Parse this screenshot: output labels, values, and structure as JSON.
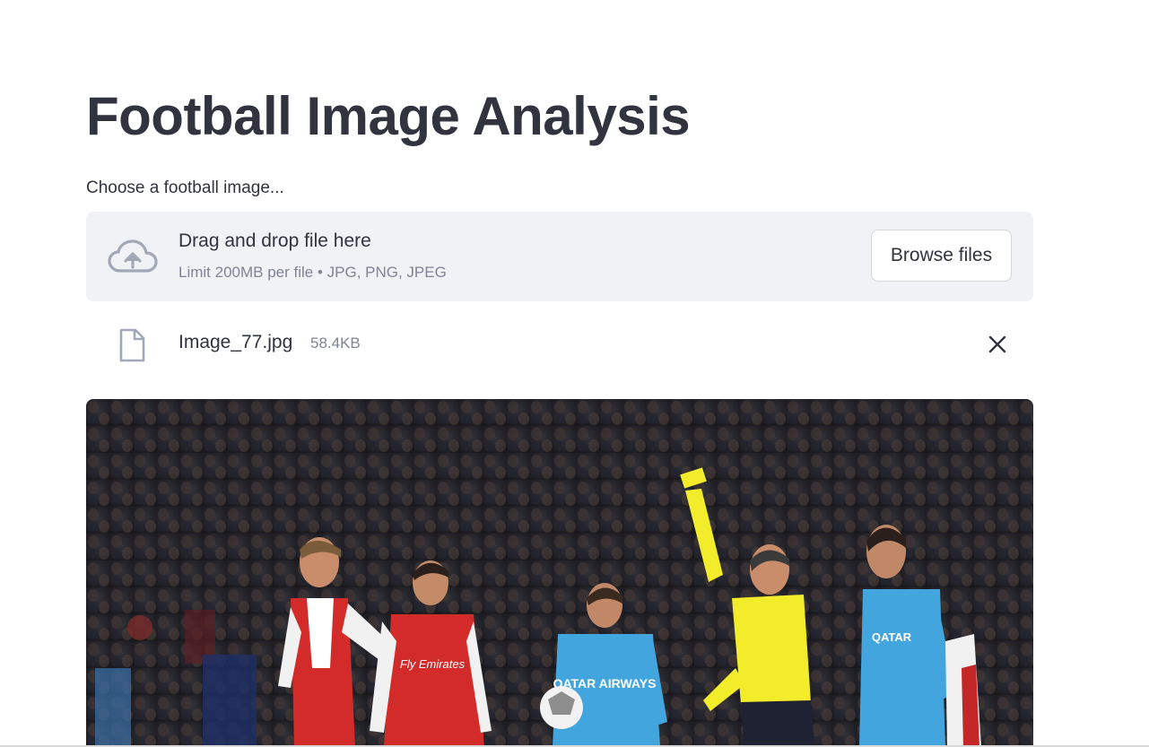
{
  "page": {
    "title": "Football Image Analysis"
  },
  "uploader": {
    "label": "Choose a football image...",
    "drop_title": "Drag and drop file here",
    "drop_subtitle": "Limit 200MB per file • JPG, PNG, JPEG",
    "browse_label": "Browse files",
    "cloud_icon": "cloud-upload-icon"
  },
  "uploaded_file": {
    "name": "Image_77.jpg",
    "size": "58.4KB",
    "file_icon": "file-icon",
    "remove_icon": "close-icon"
  },
  "image": {
    "kit_on_shirt": "Fly Emirates",
    "kit_on_blue_shirt": "QATAR AIRWAYS"
  },
  "colors": {
    "text": "#31333f",
    "muted": "#808495",
    "dropzone_bg": "#f0f2f6",
    "icon": "#a3a8b8"
  }
}
